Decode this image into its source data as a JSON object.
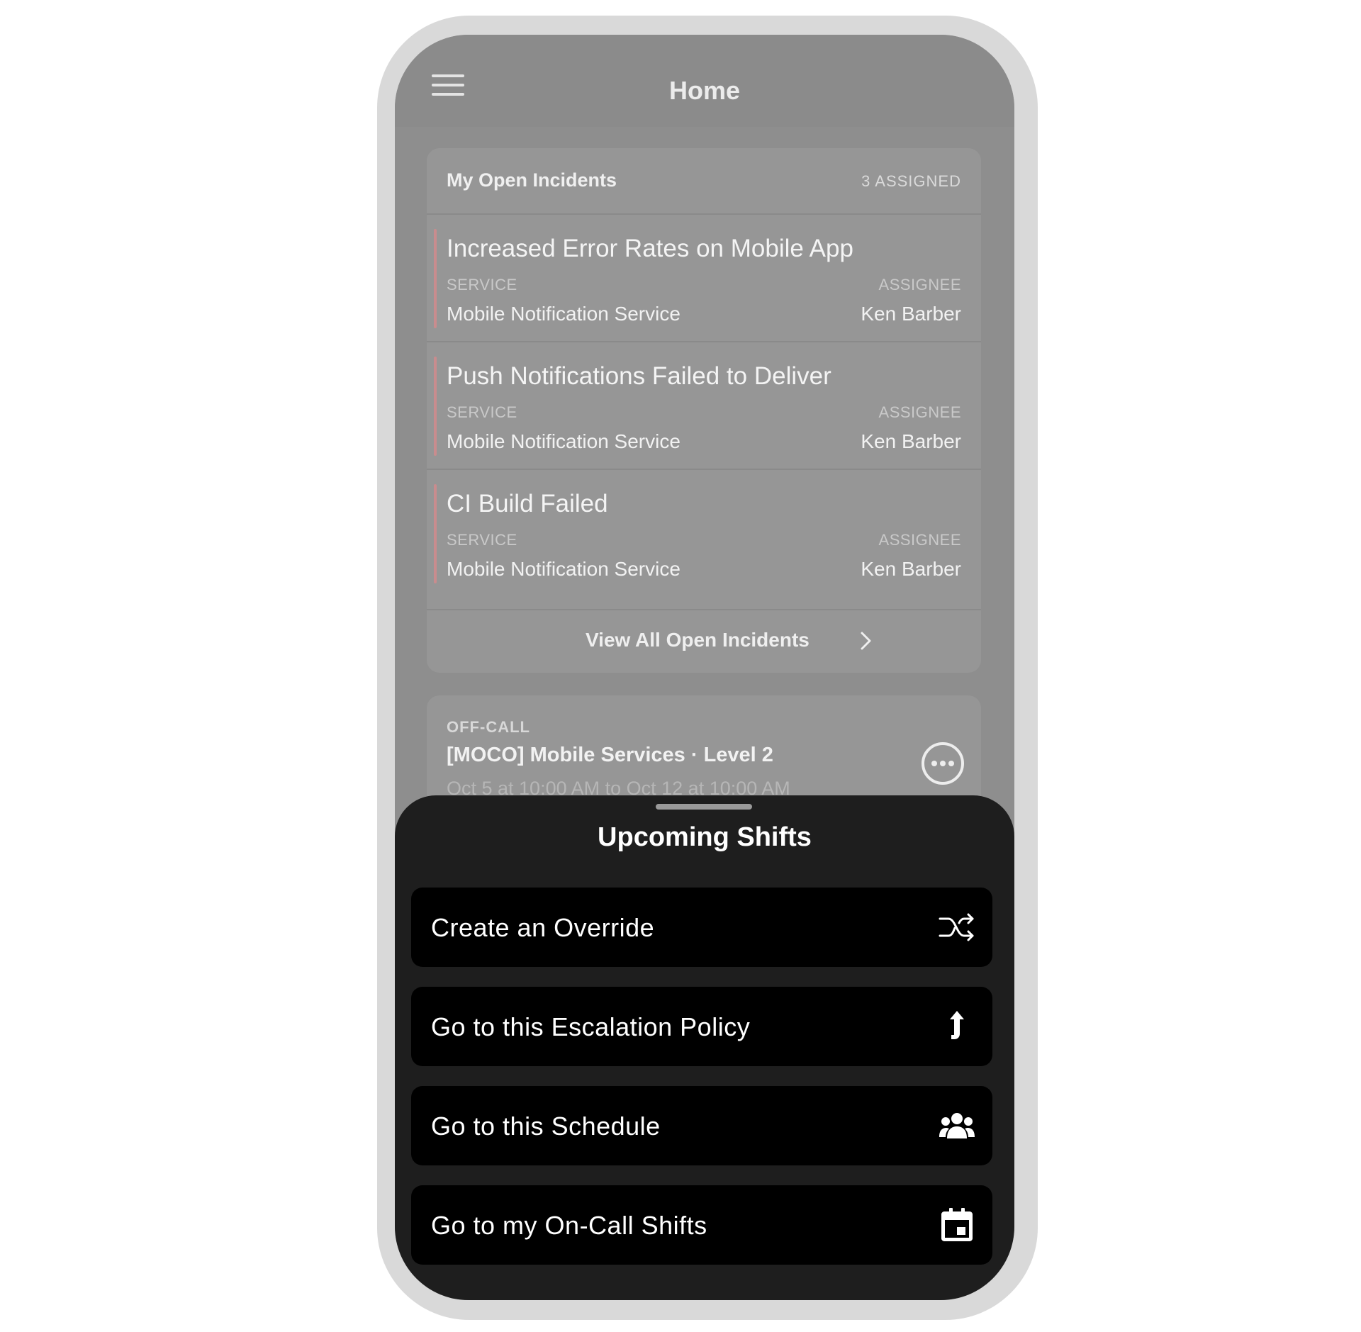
{
  "header": {
    "title": "Home",
    "menu_icon": "hamburger-menu-icon"
  },
  "incidents": {
    "title": "My Open Incidents",
    "count_label": "3 ASSIGNED",
    "service_label": "SERVICE",
    "assignee_label": "ASSIGNEE",
    "items": [
      {
        "title": "Increased Error Rates on Mobile App",
        "service": "Mobile Notification Service",
        "assignee": "Ken Barber"
      },
      {
        "title": "Push Notifications Failed to Deliver",
        "service": "Mobile Notification Service",
        "assignee": "Ken Barber"
      },
      {
        "title": "CI Build Failed",
        "service": "Mobile Notification Service",
        "assignee": "Ken Barber"
      }
    ],
    "view_all_label": "View All Open Incidents"
  },
  "oncall": {
    "status": "OFF-CALL",
    "policy": "[MOCO] Mobile Services · Level 2",
    "dates": "Oct 5 at 10:00 AM to Oct 12 at 10:00 AM"
  },
  "sheet": {
    "title": "Upcoming Shifts",
    "actions": [
      {
        "label": "Create an Override",
        "icon": "shuffle-icon"
      },
      {
        "label": "Go to this Escalation Policy",
        "icon": "arrow-up-icon"
      },
      {
        "label": "Go to this Schedule",
        "icon": "people-icon"
      },
      {
        "label": "Go to my On-Call Shifts",
        "icon": "calendar-icon"
      }
    ]
  },
  "colors": {
    "incident_accent": "#c98c8e",
    "sheet_background": "#1e1e1e",
    "action_background": "#000000"
  }
}
